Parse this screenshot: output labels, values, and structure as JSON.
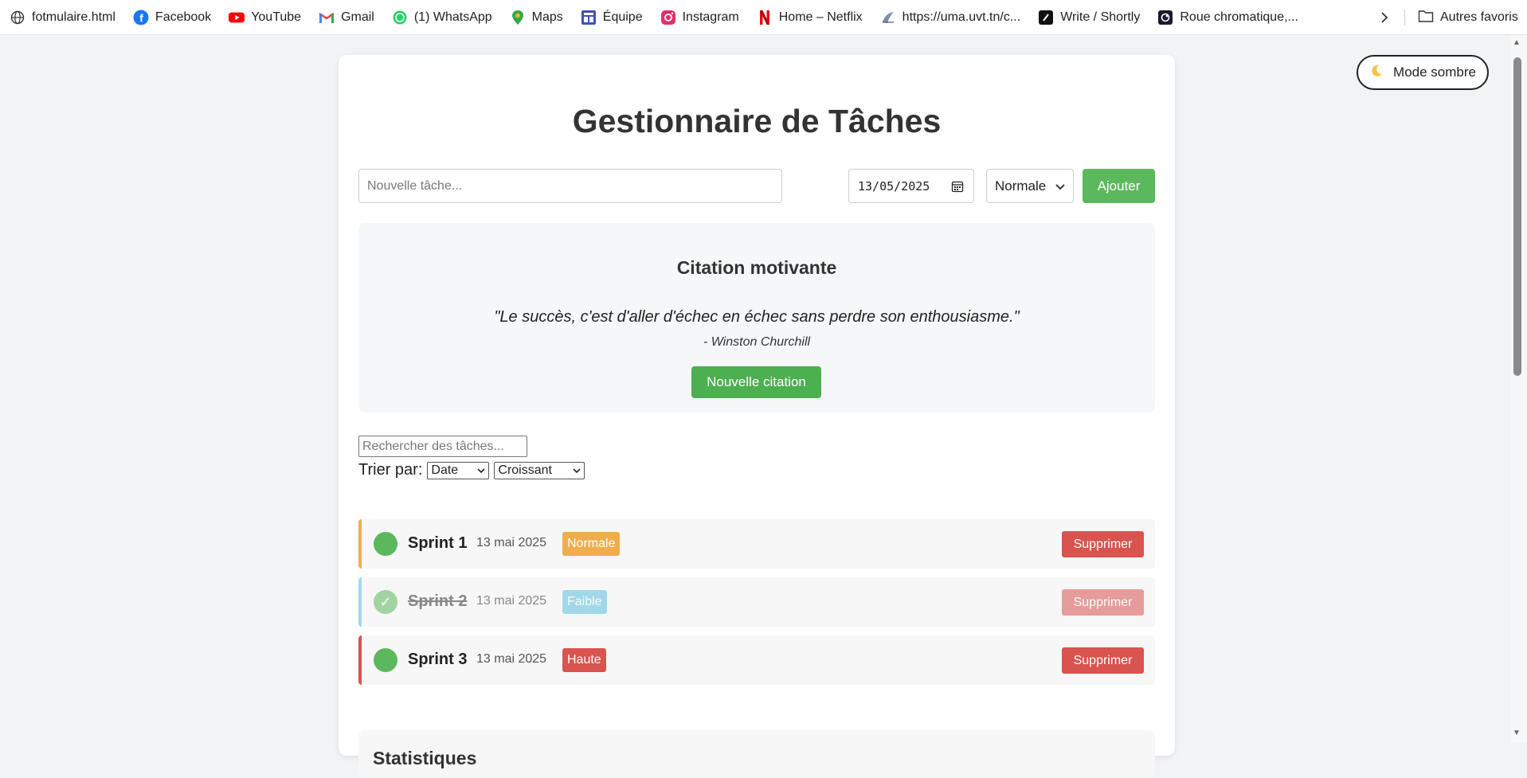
{
  "bookmarks": {
    "items": [
      {
        "label": "fotmulaire.html",
        "icon": "globe-icon"
      },
      {
        "label": "Facebook",
        "icon": "facebook-icon"
      },
      {
        "label": "YouTube",
        "icon": "youtube-icon"
      },
      {
        "label": "Gmail",
        "icon": "gmail-icon"
      },
      {
        "label": "(1) WhatsApp",
        "icon": "whatsapp-icon"
      },
      {
        "label": "Maps",
        "icon": "maps-icon"
      },
      {
        "label": "Équipe",
        "icon": "team-icon"
      },
      {
        "label": "Instagram",
        "icon": "instagram-icon"
      },
      {
        "label": "Home – Netflix",
        "icon": "netflix-icon"
      },
      {
        "label": "https://uma.uvt.tn/c...",
        "icon": "uvt-icon"
      },
      {
        "label": "Write / Shortly",
        "icon": "shortly-icon"
      },
      {
        "label": "Roue chromatique,...",
        "icon": "color-wheel-icon"
      }
    ],
    "other_label": "Autres favoris"
  },
  "dark_mode_label": "Mode sombre",
  "app": {
    "title": "Gestionnaire de Tâches",
    "task_placeholder": "Nouvelle tâche...",
    "date_value": "13/05/2025",
    "priority_selected": "Normale",
    "add_label": "Ajouter"
  },
  "quote": {
    "heading": "Citation motivante",
    "text": "\"Le succès, c'est d'aller d'échec en échec sans perdre son enthousiasme.\"",
    "author": "- Winston Churchill",
    "button_label": "Nouvelle citation"
  },
  "filters": {
    "search_placeholder": "Rechercher des tâches...",
    "sort_label": "Trier par:",
    "sort_field": "Date",
    "sort_order": "Croissant"
  },
  "tasks": [
    {
      "name": "Sprint 1",
      "date": "13 mai 2025",
      "priority": "Normale",
      "priority_color": "#f0ad4e",
      "completed": false,
      "delete_label": "Supprimer"
    },
    {
      "name": "Sprint 2",
      "date": "13 mai 2025",
      "priority": "Faible",
      "priority_color": "#5bc0de",
      "completed": true,
      "delete_label": "Supprimer"
    },
    {
      "name": "Sprint 3",
      "date": "13 mai 2025",
      "priority": "Haute",
      "priority_color": "#d9534f",
      "completed": false,
      "delete_label": "Supprimer"
    }
  ],
  "stats": {
    "title": "Statistiques"
  },
  "colors": {
    "accent_green": "#5cb85c",
    "danger_red": "#d9534f"
  }
}
